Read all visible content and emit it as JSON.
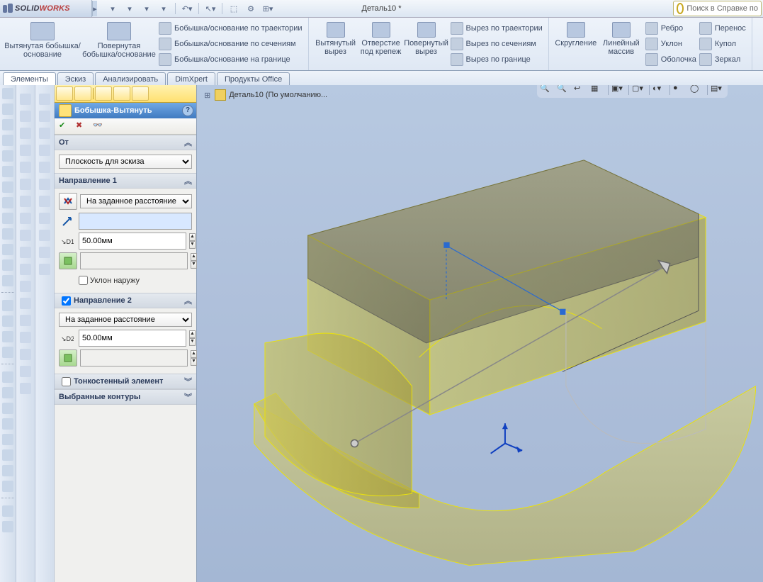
{
  "app": {
    "name": "SOLIDWORKS",
    "doc_title": "Деталь10 *",
    "search_placeholder": "Поиск в Справке по"
  },
  "ribbon": {
    "big1": "Вытянутая бобышка/основание",
    "big2": "Повернутая бобышка/основание",
    "sweep": "Бобышка/основание по траектории",
    "loft": "Бобышка/основание по сечениям",
    "boundary": "Бобышка/основание на границе",
    "cut1": "Вытянутый вырез",
    "hole": "Отверстие под крепеж",
    "cut2": "Повернутый вырез",
    "cutsweep": "Вырез по траектории",
    "cutloft": "Вырез по сечениям",
    "cutboundary": "Вырез по границе",
    "fillet": "Скругление",
    "pattern": "Линейный массив",
    "rib": "Ребро",
    "draft": "Уклон",
    "shell": "Оболочка",
    "move": "Перенос",
    "dome": "Купол",
    "mirror": "Зеркал"
  },
  "tabs": {
    "t1": "Элементы",
    "t2": "Эскиз",
    "t3": "Анализировать",
    "t4": "DimXpert",
    "t5": "Продукты Office"
  },
  "tree": {
    "crumb": "Деталь10  (По умолчанию..."
  },
  "pm": {
    "title": "Бобышка-Вытянуть",
    "from": "От",
    "from_val": "Плоскость для эскиза",
    "dir1_head": "Направление 1",
    "dir1_type": "На заданное расстояние",
    "d1_val": "50.00мм",
    "draft_out": "Уклон наружу",
    "dir2_head": "Направление 2",
    "dir2_type": "На заданное расстояние",
    "d2_val": "50.00мм",
    "thin": "Тонкостенный элемент",
    "contours": "Выбранные контуры"
  }
}
